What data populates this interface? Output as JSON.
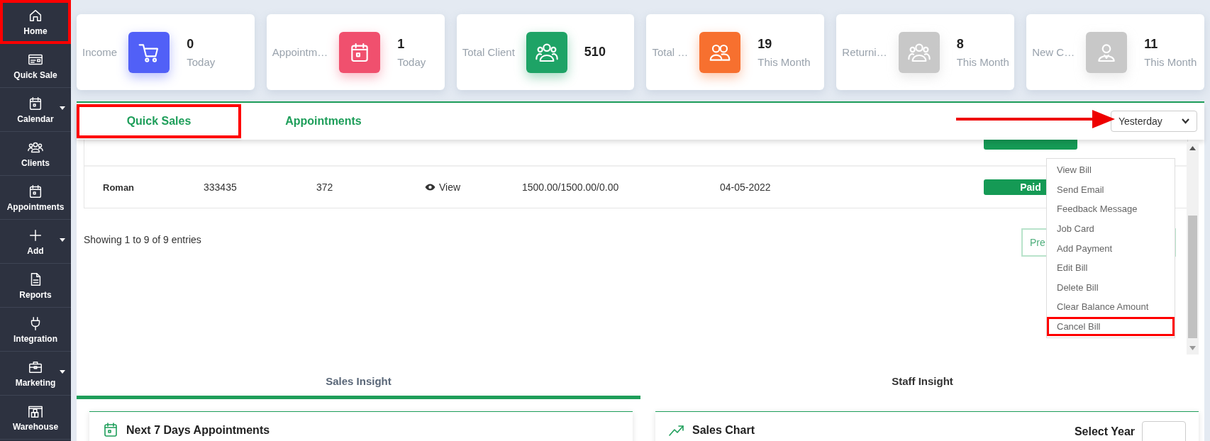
{
  "sidebar": {
    "items": [
      {
        "label": "Home",
        "has_submenu": false,
        "marked": true
      },
      {
        "label": "Quick Sale",
        "has_submenu": false,
        "marked": false
      },
      {
        "label": "Calendar",
        "has_submenu": true,
        "marked": false
      },
      {
        "label": "Clients",
        "has_submenu": false,
        "marked": false
      },
      {
        "label": "Appointments",
        "has_submenu": false,
        "marked": false
      },
      {
        "label": "Add",
        "has_submenu": true,
        "marked": false
      },
      {
        "label": "Reports",
        "has_submenu": false,
        "marked": false
      },
      {
        "label": "Integration",
        "has_submenu": false,
        "marked": false
      },
      {
        "label": "Marketing",
        "has_submenu": true,
        "marked": false
      },
      {
        "label": "Warehouse",
        "has_submenu": false,
        "marked": false
      }
    ]
  },
  "stats": [
    {
      "label": "Income",
      "color": "#5160f7",
      "value": "0",
      "period": "Today"
    },
    {
      "label": "Appointm…",
      "color": "#f0506e",
      "value": "1",
      "period": "Today"
    },
    {
      "label": "Total Client",
      "color": "#1ea366",
      "value": "510"
    },
    {
      "label": "Total …",
      "color": "#f7702f",
      "value": "19",
      "period": "This Month"
    },
    {
      "label": "Returni…",
      "color": "#c8c8c8",
      "value": "8",
      "period": "This Month"
    },
    {
      "label": "New C…",
      "color": "#c8c8c8",
      "value": "11",
      "period": "This Month"
    }
  ],
  "tabs": [
    {
      "label": "Quick Sales",
      "selected": true,
      "marked": true
    },
    {
      "label": "Appointments",
      "selected": false,
      "marked": false
    }
  ],
  "date_filter": {
    "value": "Yesterday",
    "arrow": true
  },
  "table": {
    "rows": [
      {
        "clipped": true
      },
      {
        "clipped": false,
        "column_1": "Roman",
        "column_2": "333435",
        "column_3": "372",
        "column_4": "View",
        "column_5": "1500.00/1500.00/0.00",
        "column_6": "04-05-2022",
        "column_7": "Paid"
      }
    ]
  },
  "entries_info": "Showing 1 to 9 of 9 entries",
  "pagination": {
    "label": "Pre"
  },
  "row_menu": {
    "items": [
      {
        "label": "View Bill",
        "marked": false
      },
      {
        "label": "Send Email",
        "marked": false
      },
      {
        "label": "Feedback Message",
        "marked": false
      },
      {
        "label": "Job Card",
        "marked": false
      },
      {
        "label": "Add Payment",
        "marked": false
      },
      {
        "label": "Edit Bill",
        "marked": false
      },
      {
        "label": "Delete Bill",
        "marked": false
      },
      {
        "label": "Clear Balance Amount",
        "marked": false
      },
      {
        "label": "Cancel Bill",
        "marked": true
      }
    ]
  },
  "insight_tabs": [
    {
      "label": "Sales Insight",
      "selected": true
    },
    {
      "label": "Staff Insight",
      "selected": false
    }
  ],
  "insight_cards": [
    {
      "title": "Next 7 Days Appointments"
    },
    {
      "title": "Sales Chart",
      "select_label": "Select Year"
    }
  ]
}
